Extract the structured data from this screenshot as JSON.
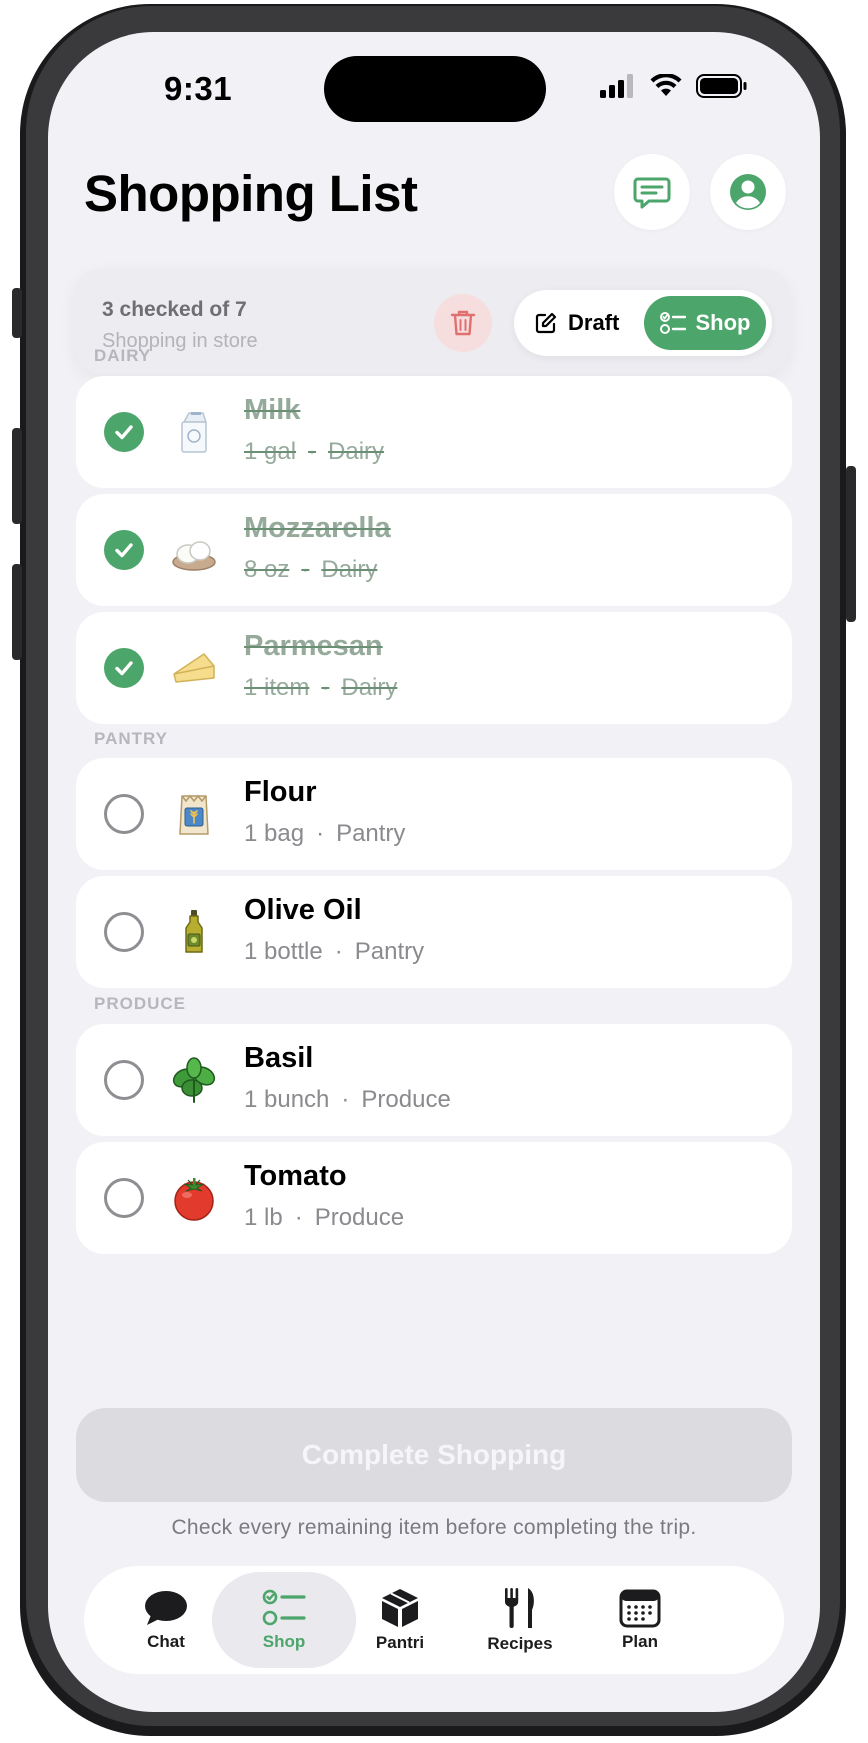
{
  "status_bar": {
    "time": "9:31"
  },
  "header": {
    "title": "Shopping List",
    "chat_icon": "message-icon",
    "profile_icon": "person-icon"
  },
  "summary": {
    "count": "3 checked of 7",
    "mode_text": "Shopping in store"
  },
  "modes": {
    "draft": "Draft",
    "shop": "Shop",
    "active": "Shop"
  },
  "sections": {
    "dairy": "DAIRY",
    "pantry": "PANTRY",
    "produce": "PRODUCE"
  },
  "items": [
    {
      "name": "Milk",
      "qty": "1 gal",
      "category": "Dairy",
      "checked": true,
      "icon": "milk-carton-icon"
    },
    {
      "name": "Mozzarella",
      "qty": "8 oz",
      "category": "Dairy",
      "checked": true,
      "icon": "mozzarella-icon"
    },
    {
      "name": "Parmesan",
      "qty": "1 item",
      "category": "Dairy",
      "checked": true,
      "icon": "cheese-icon"
    },
    {
      "name": "Flour",
      "qty": "1 bag",
      "category": "Pantry",
      "checked": false,
      "icon": "flour-bag-icon"
    },
    {
      "name": "Olive Oil",
      "qty": "1 bottle",
      "category": "Pantry",
      "checked": false,
      "icon": "olive-oil-icon"
    },
    {
      "name": "Basil",
      "qty": "1 bunch",
      "category": "Produce",
      "checked": false,
      "icon": "basil-icon"
    },
    {
      "name": "Tomato",
      "qty": "1 lb",
      "category": "Produce",
      "checked": false,
      "icon": "tomato-icon"
    }
  ],
  "meta_separator": "·",
  "complete_button": "Complete Shopping",
  "hint": "Check every remaining item before completing the trip.",
  "tabs": [
    {
      "label": "Chat",
      "icon": "chat-bubble-icon"
    },
    {
      "label": "Shop",
      "icon": "checklist-icon",
      "active": true
    },
    {
      "label": "Pantri",
      "icon": "box-icon"
    },
    {
      "label": "Recipes",
      "icon": "fork-knife-icon"
    },
    {
      "label": "Plan",
      "icon": "calendar-icon"
    }
  ],
  "colors": {
    "accent": "#4ca56a",
    "danger": "#e07070",
    "background": "#f2f2f6"
  }
}
